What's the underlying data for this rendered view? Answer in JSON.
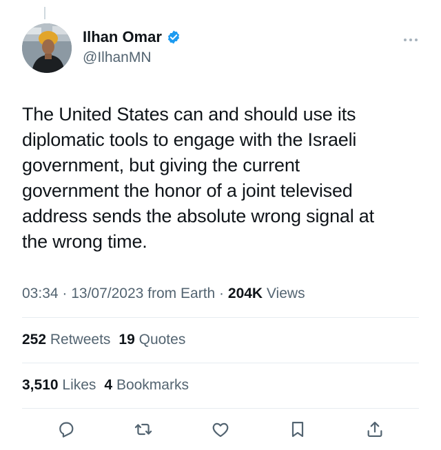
{
  "author": {
    "display_name": "Ilhan Omar",
    "handle": "@IlhanMN",
    "verified": true,
    "avatar_icon": "profile-photo"
  },
  "tweet": {
    "text": "The United States can and should use its\ndiplomatic tools to engage with the Israeli\ngovernment, but giving the current\ngovernment the honor of a joint televised\naddress sends the absolute wrong signal at\nthe wrong time."
  },
  "meta": {
    "time": "03:34",
    "separator1": " · ",
    "date": "13/07/2023",
    "source": " from Earth",
    "separator2": " · ",
    "views_count": "204K",
    "views_label": " Views"
  },
  "stats": {
    "retweets_count": "252",
    "retweets_label": " Retweets",
    "quotes_count": "19",
    "quotes_label": " Quotes",
    "likes_count": "3,510",
    "likes_label": " Likes",
    "bookmarks_count": "4",
    "bookmarks_label": " Bookmarks"
  },
  "actions": [
    "reply-icon",
    "retweet-icon",
    "like-icon",
    "bookmark-icon",
    "share-icon"
  ],
  "colors": {
    "verified_blue": "#1d9bf0",
    "text_primary": "#0f1419",
    "text_secondary": "#536471",
    "divider": "#e6ecf0"
  }
}
